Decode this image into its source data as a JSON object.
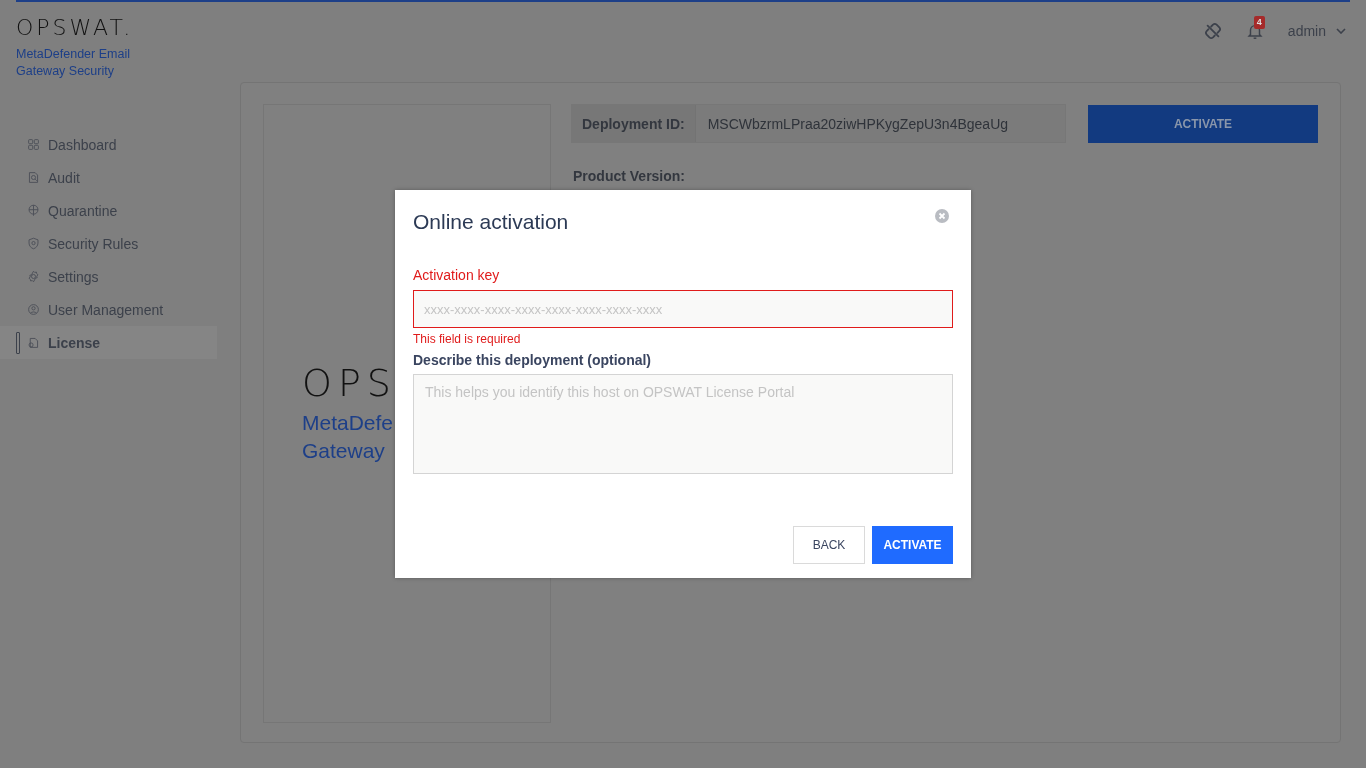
{
  "header": {
    "brand": "OPSWAT.",
    "product": "MetaDefender Email Gateway Security",
    "notifications_count": "4",
    "user": "admin"
  },
  "sidebar": {
    "items": [
      {
        "label": "Dashboard",
        "selected": false
      },
      {
        "label": "Audit",
        "selected": false
      },
      {
        "label": "Quarantine",
        "selected": false
      },
      {
        "label": "Security Rules",
        "selected": false
      },
      {
        "label": "Settings",
        "selected": false
      },
      {
        "label": "User Management",
        "selected": false
      },
      {
        "label": "License",
        "selected": true
      }
    ]
  },
  "license": {
    "logo": {
      "brand": "OPS",
      "product_lines": [
        "MetaDefe",
        "Gateway"
      ]
    },
    "deployment_id_label": "Deployment ID:",
    "deployment_id": "MSCWbzrmLPraa20ziwHPKygZepU3n4BgeaUg",
    "activate_button": "ACTIVATE",
    "product_version_label": "Product Version:"
  },
  "modal": {
    "title": "Online activation",
    "activation_key": {
      "label": "Activation key",
      "placeholder": "xxxx-xxxx-xxxx-xxxx-xxxx-xxxx-xxxx-xxxx",
      "invalid": true,
      "error": "This field is required"
    },
    "description": {
      "label": "Describe this deployment (optional)",
      "placeholder": "This helps you identify this host on OPSWAT License Portal"
    },
    "buttons": [
      {
        "label": "BACK",
        "kind": "secondary"
      },
      {
        "label": "ACTIVATE",
        "kind": "primary"
      }
    ]
  }
}
